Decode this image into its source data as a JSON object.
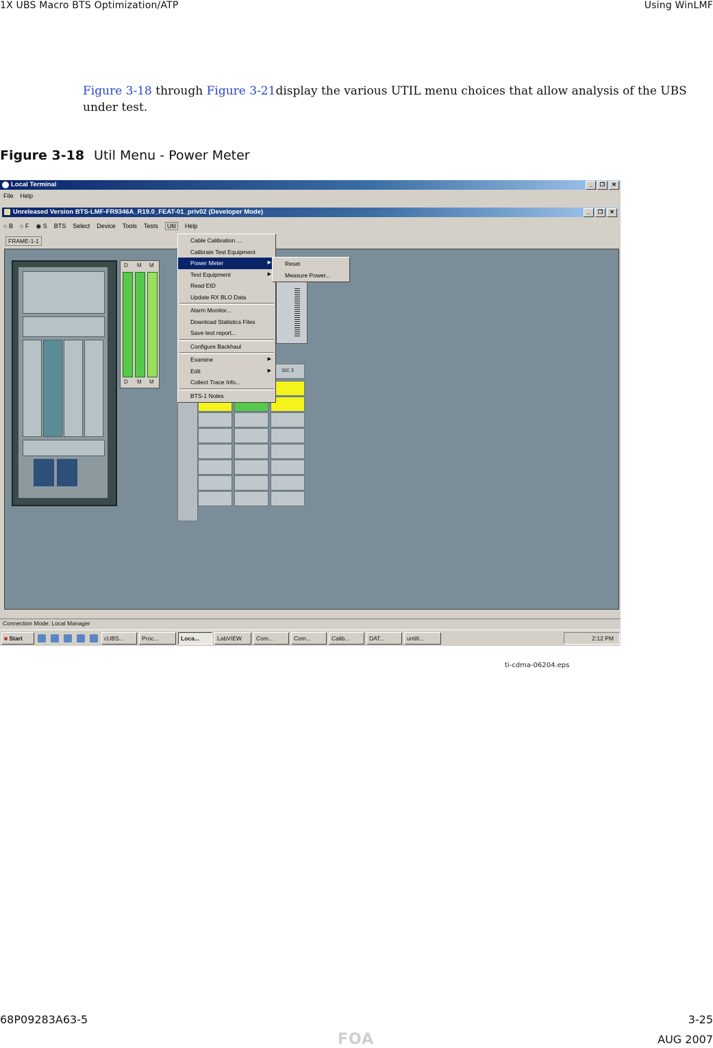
{
  "header": {
    "left": "1X UBS Macro BTS Optimization/ATP",
    "right": "Using WinLMF"
  },
  "intro": {
    "xref1": "Figure 3-18",
    "mid": " through ",
    "xref2": "Figure 3-21",
    "rest": "display the various UTIL menu choices that allow analysis of the UBS under test."
  },
  "figure": {
    "number": "Figure 3-18",
    "title": "Util Menu - Power Meter"
  },
  "screenshot": {
    "outer_title": "Local Terminal",
    "outer_menu": [
      "File",
      "Help"
    ],
    "inner_title": "Unreleased Version BTS-LMF-FR9346A_R19.0_FEAT-01_priv02 (Developer Mode)",
    "inner_menu": [
      "B",
      "F",
      "S",
      "BTS",
      "Select",
      "Device",
      "Tools",
      "Tests",
      "Util",
      "Help"
    ],
    "frame_tab": "FRAME-1-1",
    "card_labels_top": [
      "D",
      "M",
      "M"
    ],
    "card_labels_bottom": [
      "D",
      "M",
      "M"
    ],
    "grid_header": "SIC 3",
    "util_menu": [
      "Cable Calibration ...",
      "Calibrate Test Equipment",
      "Power Meter",
      "Test Equipment",
      "Read EID",
      "Update RX BLO Data",
      "Alarm Monitor...",
      "Download Statistics Files",
      "Save test report...",
      "Configure Backhaul",
      "Examine",
      "Edit",
      "Collect Trace Info...",
      "BTS-1 Notes"
    ],
    "submenu": [
      "Reset",
      "Measure Power..."
    ],
    "status": "Connection Mode: Local Manager",
    "taskbar": {
      "start": "Start",
      "buttons": [
        "cUBS...",
        "Proc...",
        "Loca...",
        "LabVIEW",
        "Com...",
        "Com...",
        "Calib...",
        "DAT...",
        "untitl..."
      ],
      "clock": "2:12 PM"
    },
    "colors": {
      "titlebar": "#0a246a",
      "card_green": "#58c84a",
      "cell_yellow": "#f4f41c",
      "canvas": "#7a8d98"
    }
  },
  "eps_name": "ti-cdma-06204.eps",
  "footer": {
    "doc": "68P09283A63-5",
    "page": "3-25",
    "watermark": "FOA",
    "date": "AUG 2007"
  }
}
